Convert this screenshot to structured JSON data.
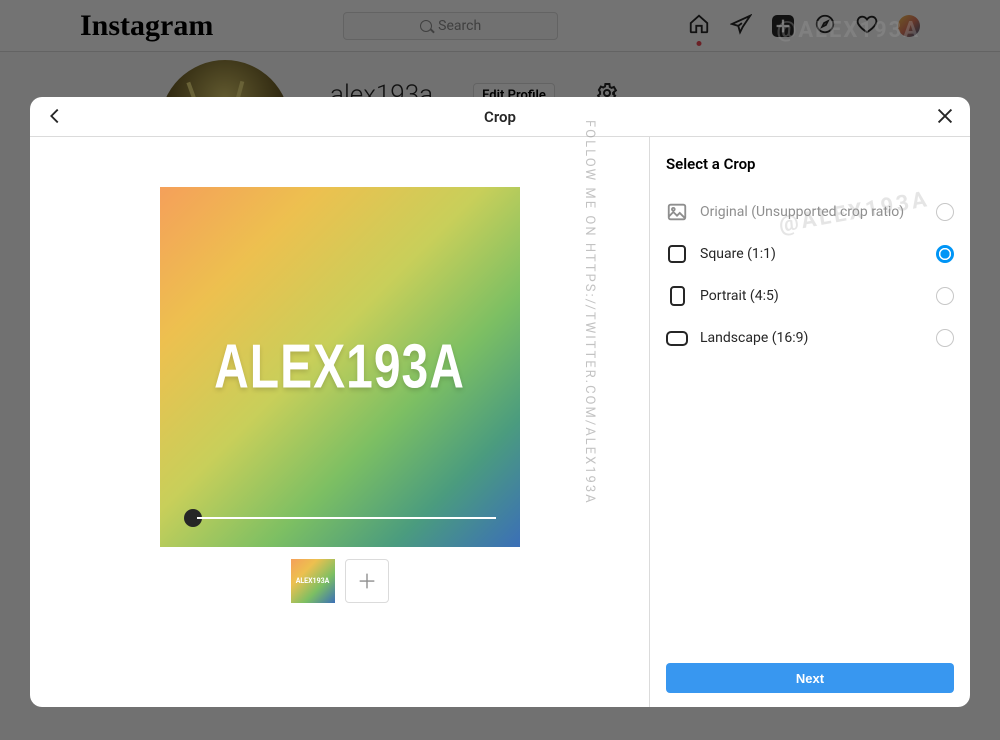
{
  "brand": "Instagram",
  "search": {
    "placeholder": "Search"
  },
  "profile": {
    "username": "alex193a",
    "edit_label": "Edit Profile"
  },
  "watermark": {
    "vertical": "FOLLOW ME ON HTTPS://TWITTER.COM/ALEX193A",
    "diag1": "@ALEX193A",
    "diag2": "@ALEX193A"
  },
  "modal": {
    "title": "Crop",
    "image_text": "ALEX193A",
    "thumb_text": "ALEX193A",
    "options_heading": "Select a Crop",
    "options": [
      {
        "label": "Original (Unsupported crop ratio)",
        "kind": "original",
        "disabled": true,
        "selected": false
      },
      {
        "label": "Square (1:1)",
        "kind": "square",
        "disabled": false,
        "selected": true
      },
      {
        "label": "Portrait (4:5)",
        "kind": "portrait",
        "disabled": false,
        "selected": false
      },
      {
        "label": "Landscape (16:9)",
        "kind": "landscape",
        "disabled": false,
        "selected": false
      }
    ],
    "next_label": "Next"
  }
}
